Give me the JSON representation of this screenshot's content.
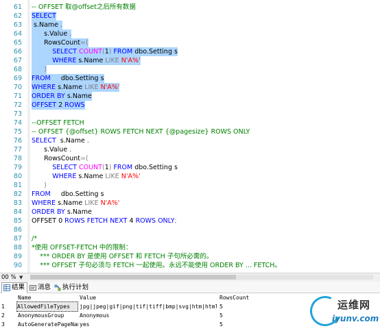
{
  "editor": {
    "lines": [
      {
        "n": "61",
        "sel": false,
        "parts": [
          [
            "cm",
            "-- OFFSET 取@offset之后所有数据"
          ]
        ]
      },
      {
        "n": "62",
        "sel": true,
        "parts": [
          [
            "kw",
            "SELECT"
          ]
        ]
      },
      {
        "n": "63",
        "sel": true,
        "parts": [
          [
            "id",
            " s.Name"
          ],
          [
            "gr",
            " ,"
          ]
        ]
      },
      {
        "n": "64",
        "sel": true,
        "parts": [
          [
            "id",
            "      s.Value"
          ],
          [
            "gr",
            " ,"
          ]
        ]
      },
      {
        "n": "65",
        "sel": true,
        "parts": [
          [
            "id",
            "      RowsCount"
          ],
          [
            "gr",
            "=("
          ]
        ]
      },
      {
        "n": "66",
        "sel": true,
        "parts": [
          [
            "kw",
            "          SELECT "
          ],
          [
            "fn",
            "COUNT"
          ],
          [
            "gr",
            "("
          ],
          [
            "id",
            "1"
          ],
          [
            "gr",
            ")"
          ],
          [
            "kw",
            " FROM"
          ],
          [
            "id",
            " dbo.Setting s"
          ]
        ]
      },
      {
        "n": "67",
        "sel": true,
        "parts": [
          [
            "kw",
            "          WHERE"
          ],
          [
            "id",
            " s.Name "
          ],
          [
            "gr",
            "LIKE "
          ],
          [
            "str",
            "N'A%'"
          ]
        ]
      },
      {
        "n": "68",
        "sel": true,
        "parts": [
          [
            "gr",
            "      )"
          ]
        ]
      },
      {
        "n": "69",
        "sel": true,
        "parts": [
          [
            "kw",
            "FROM"
          ],
          [
            "id",
            "     dbo.Setting s"
          ]
        ]
      },
      {
        "n": "70",
        "sel": true,
        "parts": [
          [
            "kw",
            "WHERE"
          ],
          [
            "id",
            " s.Name "
          ],
          [
            "gr",
            "LIKE "
          ],
          [
            "str",
            "N'A%'"
          ]
        ]
      },
      {
        "n": "71",
        "sel": true,
        "parts": [
          [
            "kw",
            "ORDER BY"
          ],
          [
            "id",
            " s.Name"
          ]
        ]
      },
      {
        "n": "72",
        "sel": true,
        "parts": [
          [
            "kw",
            "OFFSET"
          ],
          [
            "id",
            " 2 "
          ],
          [
            "kw",
            "ROWS"
          ]
        ]
      },
      {
        "n": "73",
        "sel": false,
        "parts": []
      },
      {
        "n": "74",
        "sel": false,
        "parts": [
          [
            "cm",
            "--OFFSET FETCH"
          ]
        ]
      },
      {
        "n": "75",
        "sel": false,
        "parts": [
          [
            "cm",
            "-- OFFSET {@offset} ROWS FETCH NEXT {@pagesize} ROWS ONLY"
          ]
        ]
      },
      {
        "n": "76",
        "sel": false,
        "parts": [
          [
            "kw",
            "SELECT"
          ],
          [
            "id",
            "  s.Name"
          ],
          [
            "gr",
            " ,"
          ]
        ]
      },
      {
        "n": "77",
        "sel": false,
        "parts": [
          [
            "id",
            "      s.Value"
          ],
          [
            "gr",
            " ,"
          ]
        ]
      },
      {
        "n": "78",
        "sel": false,
        "parts": [
          [
            "id",
            "      RowsCount"
          ],
          [
            "gr",
            "=("
          ]
        ]
      },
      {
        "n": "79",
        "sel": false,
        "parts": [
          [
            "kw",
            "          SELECT "
          ],
          [
            "fn",
            "COUNT"
          ],
          [
            "gr",
            "("
          ],
          [
            "id",
            "1"
          ],
          [
            "gr",
            ")"
          ],
          [
            "kw",
            " FROM"
          ],
          [
            "id",
            " dbo.Setting s"
          ]
        ]
      },
      {
        "n": "80",
        "sel": false,
        "parts": [
          [
            "kw",
            "          WHERE"
          ],
          [
            "id",
            " s.Name "
          ],
          [
            "gr",
            "LIKE "
          ],
          [
            "str",
            "N'A%'"
          ]
        ]
      },
      {
        "n": "81",
        "sel": false,
        "parts": [
          [
            "gr",
            "      )"
          ]
        ]
      },
      {
        "n": "82",
        "sel": false,
        "parts": [
          [
            "kw",
            "FROM"
          ],
          [
            "id",
            "     dbo.Setting s"
          ]
        ]
      },
      {
        "n": "83",
        "sel": false,
        "parts": [
          [
            "kw",
            "WHERE"
          ],
          [
            "id",
            " s.Name "
          ],
          [
            "gr",
            "LIKE "
          ],
          [
            "str",
            "N'A%'"
          ]
        ]
      },
      {
        "n": "84",
        "sel": false,
        "parts": [
          [
            "kw",
            "ORDER BY"
          ],
          [
            "id",
            " s.Name"
          ]
        ]
      },
      {
        "n": "85",
        "sel": false,
        "parts": [
          [
            "id",
            "OFFSET 0 "
          ],
          [
            "kw",
            "ROWS FETCH NEXT"
          ],
          [
            "id",
            " 4 "
          ],
          [
            "kw",
            "ROWS ONLY"
          ],
          [
            "gr",
            ";"
          ]
        ]
      },
      {
        "n": "86",
        "sel": false,
        "parts": []
      },
      {
        "n": "87",
        "sel": false,
        "parts": [
          [
            "cm",
            "/*"
          ]
        ]
      },
      {
        "n": "88",
        "sel": false,
        "parts": [
          [
            "cm",
            "*使用 OFFSET-FETCH 中的限制："
          ]
        ]
      },
      {
        "n": "89",
        "sel": false,
        "parts": [
          [
            "cm",
            "    *** ORDER BY 是使用 OFFSET 和 FETCH 子句所必需的。"
          ]
        ]
      },
      {
        "n": "90",
        "sel": false,
        "parts": [
          [
            "cm",
            "    *** OFFSET 子句必须与 FETCH 一起使用。永远不能使用 ORDER BY ... FETCH。"
          ]
        ]
      }
    ]
  },
  "statusbar": {
    "zoom": "00 %",
    "zoom_arrow": "▼"
  },
  "results_tabs": [
    {
      "label": "结果",
      "icon": "grid-icon",
      "active": true
    },
    {
      "label": "消息",
      "icon": "message-icon",
      "active": false
    },
    {
      "label": "执行计划",
      "icon": "execution-plan-icon",
      "active": false
    }
  ],
  "grid": {
    "columns": [
      "Name",
      "Value",
      "RowsCount"
    ],
    "rows": [
      {
        "num": "1",
        "cells": [
          "AllowedFileTypes",
          "jpg|jpeg|gif|png|tif|tiff|bmp|svg|htm|html|zip|...",
          "5"
        ]
      },
      {
        "num": "2",
        "cells": [
          "AnonymousGroup",
          "Anonymous",
          "5"
        ]
      },
      {
        "num": "3",
        "cells": [
          "AutoGeneratePageNames",
          "yes",
          "5"
        ]
      }
    ]
  },
  "watermark": {
    "line1": "运维网",
    "line2": "iyunv.com"
  },
  "colors": {
    "keyword": "#0000ff",
    "function": "#ff00ff",
    "string": "#ff0000",
    "comment": "#008000",
    "selection": "#add6ff",
    "line_number": "#2b91af"
  }
}
